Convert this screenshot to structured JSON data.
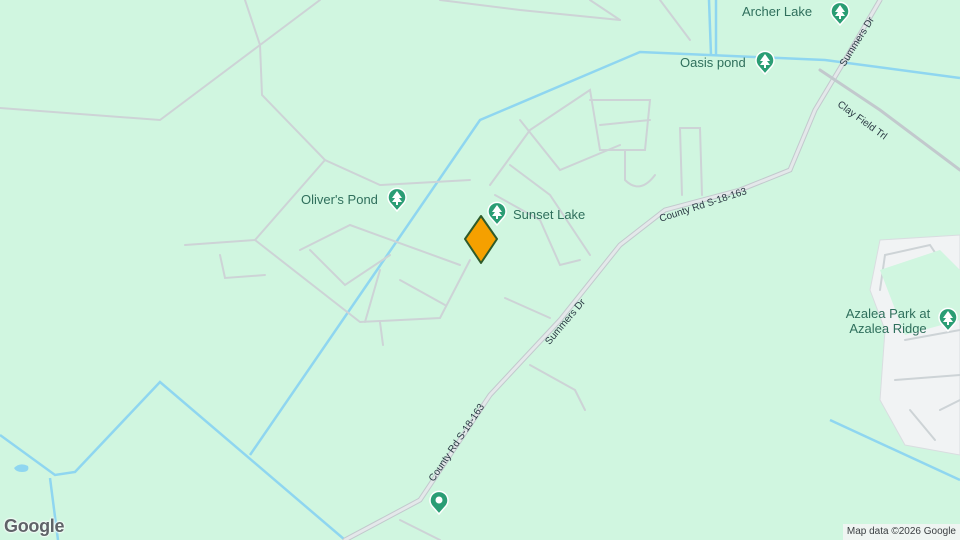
{
  "colors": {
    "land": "#d0f6e0",
    "water": "#8fd6f0",
    "road": "#d9dde0",
    "road_outline": "#c2c9cd",
    "park_pin": "#2a9d74",
    "label": "#2f6f5c",
    "marker_fill": "#f5a000",
    "marker_stroke": "#2f5b2a",
    "developed": "#f1f3f4"
  },
  "places": [
    {
      "name": "Archer Lake",
      "icon": "tree-icon"
    },
    {
      "name": "Oasis pond",
      "icon": "tree-icon"
    },
    {
      "name": "Oliver's Pond",
      "icon": "tree-icon"
    },
    {
      "name": "Sunset Lake",
      "icon": "tree-icon"
    },
    {
      "name": "Azalea Park at",
      "name2": "Azalea Ridge",
      "icon": "tree-icon"
    },
    {
      "name": "",
      "icon": "circle-pin-icon"
    }
  ],
  "roads": [
    {
      "name": "Summers Dr"
    },
    {
      "name": "Clay Field Trl"
    },
    {
      "name": "County Rd S-18-163"
    },
    {
      "name": "Summers Dr"
    },
    {
      "name": "County Rd S-18-163"
    }
  ],
  "marker": {
    "icon": "location-marker-icon"
  },
  "branding": {
    "logo": "Google",
    "attribution": "Map data ©2026 Google"
  }
}
